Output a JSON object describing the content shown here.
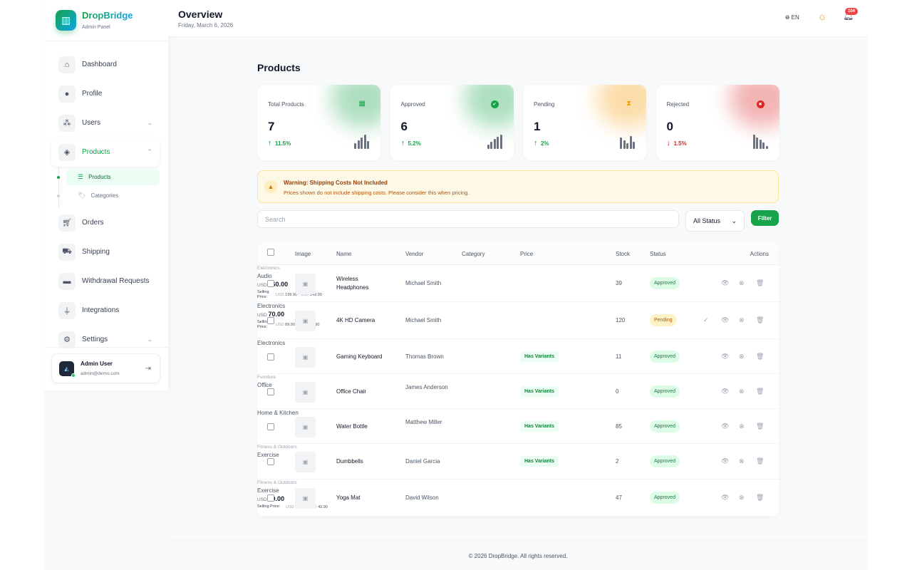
{
  "brand": {
    "name": "DropBridge",
    "subtitle": "Admin Panel"
  },
  "sidebar": {
    "items": [
      {
        "label": "Dashboard",
        "icon": "home-icon"
      },
      {
        "label": "Profile",
        "icon": "user-circle-icon"
      },
      {
        "label": "Users",
        "icon": "users-icon"
      },
      {
        "label": "Products",
        "icon": "box-icon"
      },
      {
        "label": "Orders",
        "icon": "cart-icon"
      },
      {
        "label": "Shipping",
        "icon": "truck-icon"
      },
      {
        "label": "Withdrawal Requests",
        "icon": "wallet-icon"
      },
      {
        "label": "Integrations",
        "icon": "plug-icon"
      },
      {
        "label": "Settings",
        "icon": "gears-icon"
      }
    ],
    "sub_items": [
      {
        "label": "Products"
      },
      {
        "label": "Categories"
      }
    ],
    "user": {
      "name": "Admin User",
      "email": "admin@demo.com"
    }
  },
  "header": {
    "title": "Overview",
    "date": "Friday, March 6, 2026",
    "lang": "EN",
    "notifications": "104"
  },
  "page": {
    "title": "Products"
  },
  "stats": [
    {
      "label": "Total Products",
      "value": "7",
      "change": "11.5%",
      "direction": "up",
      "color": "#16a34a",
      "bars": [
        8,
        12,
        16,
        20,
        11
      ]
    },
    {
      "label": "Approved",
      "value": "6",
      "change": "5.2%",
      "direction": "up",
      "color": "#16a34a",
      "bars": [
        6,
        10,
        14,
        17,
        20
      ]
    },
    {
      "label": "Pending",
      "value": "1",
      "change": "2%",
      "direction": "up",
      "color": "#f59e0b",
      "bars": [
        16,
        12,
        8,
        18,
        10
      ]
    },
    {
      "label": "Rejected",
      "value": "0",
      "change": "1.5%",
      "direction": "down",
      "color": "#dc2626",
      "bars": [
        20,
        16,
        13,
        9,
        4
      ]
    }
  ],
  "warning": {
    "title": "Warning: Shipping Costs Not Included",
    "text": "Prices shown do not include shipping costs. Please consider this when pricing."
  },
  "filters": {
    "search_placeholder": "Search",
    "status": "All Status",
    "filter_label": "Filter"
  },
  "table": {
    "columns": [
      "Image",
      "Name",
      "Vendor",
      "Category",
      "Price",
      "Stock",
      "Status",
      "Actions"
    ],
    "selling_label": "Selling Price:",
    "has_variants": "Has Variants",
    "rows": [
      {
        "name": "Wireless Headphones",
        "vendor": "Michael Smith",
        "parent_category": "Electronics",
        "category": "Audio",
        "currency": "USD",
        "price": "160.00",
        "sell_min": "199.90",
        "sell_max": "249.90",
        "stock": "39",
        "status": "Approved"
      },
      {
        "name": "4K HD Camera",
        "vendor": "Michael Smith",
        "parent_category": "",
        "category": "Electronics",
        "currency": "USD",
        "price": "70.00",
        "sell_min": "89.90",
        "sell_max": "119.90",
        "stock": "120",
        "status": "Pending"
      },
      {
        "name": "Gaming Keyboard",
        "vendor": "Thomas Brown",
        "parent_category": "",
        "category": "Electronics",
        "variants": true,
        "stock": "11",
        "status": "Approved"
      },
      {
        "name": "Office Chair",
        "vendor": "James Anderson",
        "parent_category": "Furniture",
        "category": "Office",
        "variants": true,
        "stock": "0",
        "status": "Approved"
      },
      {
        "name": "Water Bottle",
        "vendor": "Matthew Miller",
        "parent_category": "",
        "category": "Home & Kitchen",
        "variants": true,
        "stock": "85",
        "status": "Approved"
      },
      {
        "name": "Dumbbells",
        "vendor": "Daniel Garcia",
        "parent_category": "Fitness & Outdoors",
        "category": "Exercise",
        "variants": true,
        "stock": "2",
        "status": "Approved"
      },
      {
        "name": "Yoga Mat",
        "vendor": "David Wilson",
        "parent_category": "Fitness & Outdoors",
        "category": "Exercise",
        "currency": "USD",
        "price": "20.00",
        "sell_min": "29.90",
        "sell_max": "49.90",
        "stock": "47",
        "status": "Approved"
      }
    ]
  },
  "footer": "© 2026 DropBridge. All rights reserved."
}
